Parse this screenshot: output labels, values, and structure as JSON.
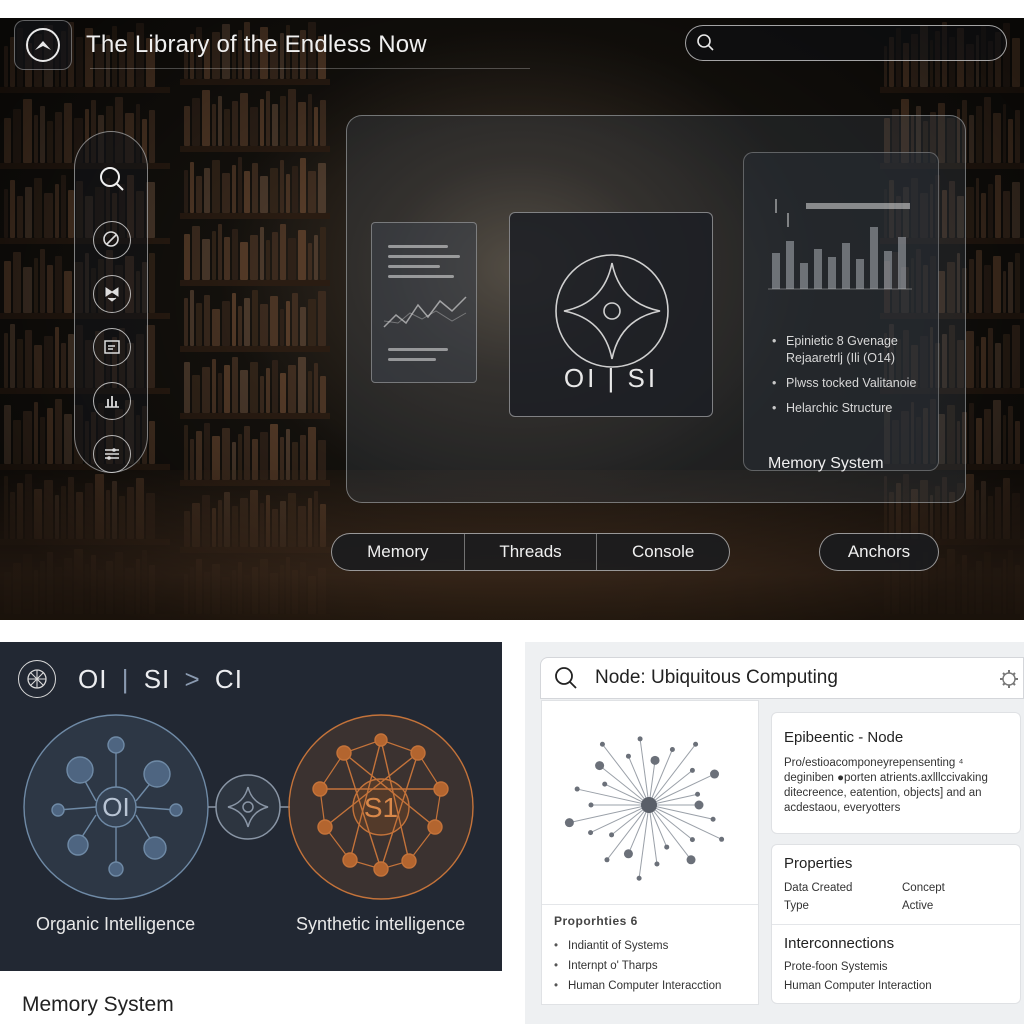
{
  "app": {
    "title": "The Library of the Endless Now"
  },
  "search": {
    "placeholder": ""
  },
  "core": {
    "label": "OI | SI"
  },
  "memory_panel": {
    "title": "Memory System",
    "items": [
      "Epinietic 8 Gvenage Rejaaretrlj (Ili (O14)",
      "Plwss tocked Valitanoie",
      "Helarchic Structure"
    ]
  },
  "tabs": [
    "Memory",
    "Threads",
    "Console"
  ],
  "anchors_label": "Anchors",
  "bottom_left": {
    "title_parts": [
      "OI",
      "|",
      "SI",
      ">",
      "CI"
    ],
    "oi_center": "OI",
    "si_center": "S1",
    "left_label": "Organic Intelligence",
    "right_label": "Synthetic intelligence",
    "caption": "Memory System",
    "colors": {
      "organic": "#6f8aa6",
      "synthetic": "#c4733a"
    }
  },
  "node_panel": {
    "title": "Node: Ubiquitous Computing",
    "epi": {
      "title": "Epibeentic - Node",
      "lines": [
        "Pro/estioacomponeyrepensenting ⁴",
        "deginiben ●porten atrients.axlllccivaking",
        "ditecreence, eatention, objects] and an",
        "acdestaou, everyotters"
      ]
    },
    "properties": {
      "title": "Properties",
      "rows": [
        [
          "Data Created",
          "Concept"
        ],
        [
          "Type",
          "Active"
        ]
      ]
    },
    "interconnections": {
      "title": "Interconnections",
      "items": [
        "Prote-foon Systemis",
        "Human Computer Interaction"
      ]
    },
    "small_props": {
      "title": "Proporhties 6",
      "items": [
        "Indiantit of Systems",
        "Internpt o' Tharps",
        "Human Computer Interacction"
      ]
    }
  }
}
